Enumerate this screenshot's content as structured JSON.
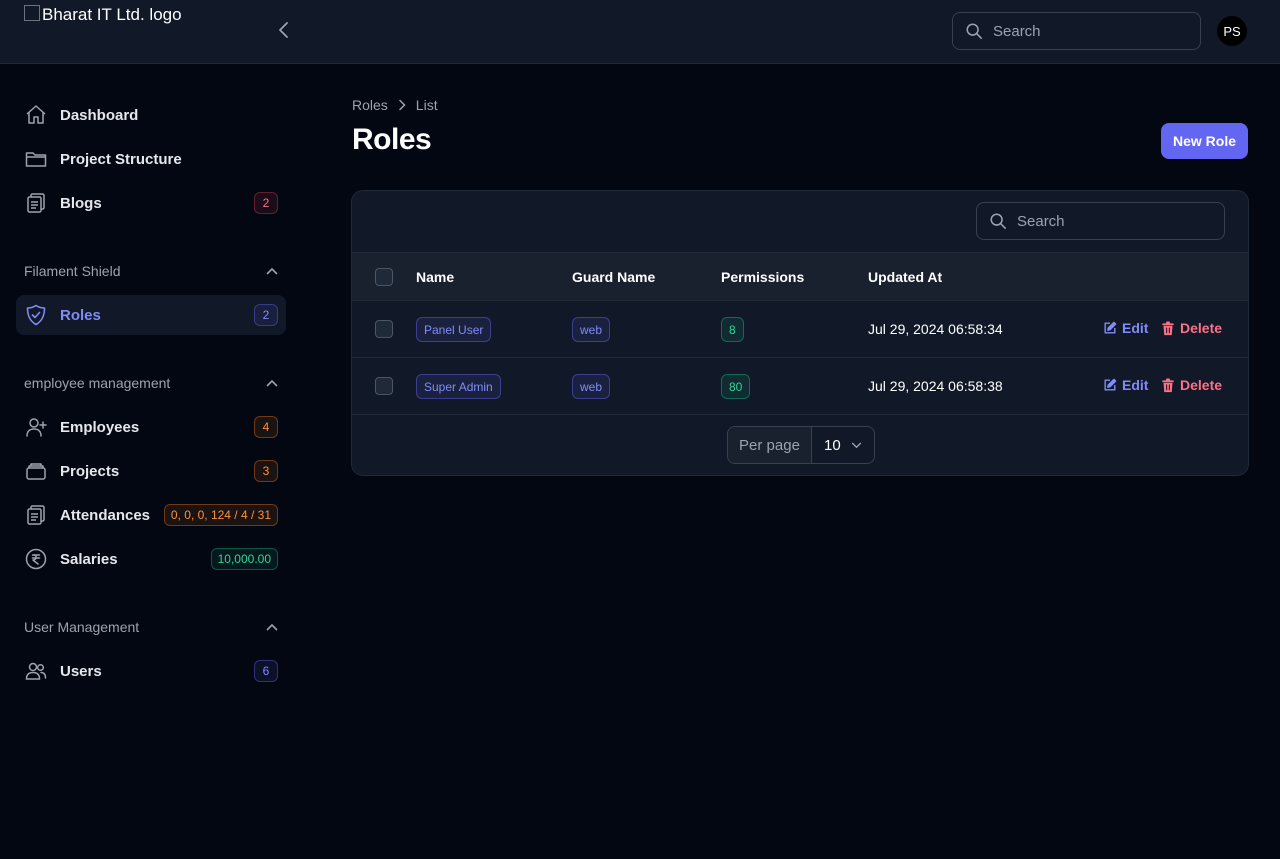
{
  "header": {
    "logo_alt": "Bharat IT Ltd. logo",
    "search_placeholder": "Search",
    "avatar_initials": "PS"
  },
  "sidebar": {
    "items": [
      {
        "label": "Dashboard",
        "icon": "home-icon"
      },
      {
        "label": "Project Structure",
        "icon": "folder-icon"
      },
      {
        "label": "Blogs",
        "icon": "clipboard-icon",
        "badge": "2",
        "badge_color": "danger"
      }
    ],
    "groups": [
      {
        "label": "Filament Shield",
        "items": [
          {
            "label": "Roles",
            "icon": "shield-check-icon",
            "badge": "2",
            "badge_color": "primary",
            "active": true
          }
        ]
      },
      {
        "label": "employee management",
        "items": [
          {
            "label": "Employees",
            "icon": "user-plus-icon",
            "badge": "4",
            "badge_color": "warning"
          },
          {
            "label": "Projects",
            "icon": "archive-box-icon",
            "badge": "3",
            "badge_color": "warning"
          },
          {
            "label": "Attendances",
            "icon": "clipboard-icon",
            "badge": "0, 0, 0, 124 / 4 / 31",
            "badge_color": "warning"
          },
          {
            "label": "Salaries",
            "icon": "rupee-icon",
            "badge": "10,000.00",
            "badge_color": "success"
          }
        ]
      },
      {
        "label": "User Management",
        "items": [
          {
            "label": "Users",
            "icon": "users-icon",
            "badge": "6",
            "badge_color": "primary"
          }
        ]
      }
    ]
  },
  "main": {
    "breadcrumb": [
      "Roles",
      "List"
    ],
    "title": "Roles",
    "new_button": "New Role",
    "table": {
      "search_placeholder": "Search",
      "columns": [
        "Name",
        "Guard Name",
        "Permissions",
        "Updated At"
      ],
      "rows": [
        {
          "name": "Panel User",
          "guard": "web",
          "permissions": "8",
          "updated_at": "Jul 29, 2024 06:58:34"
        },
        {
          "name": "Super Admin",
          "guard": "web",
          "permissions": "80",
          "updated_at": "Jul 29, 2024 06:58:38"
        }
      ],
      "actions": {
        "edit": "Edit",
        "delete": "Delete"
      }
    },
    "pagination": {
      "per_page_label": "Per page",
      "per_page_value": "10"
    }
  },
  "colors": {
    "accent": "#6366f1",
    "background": "#030712",
    "surface": "#111827",
    "danger": "#fb7185",
    "warning": "#fb923c",
    "success": "#34d399"
  }
}
